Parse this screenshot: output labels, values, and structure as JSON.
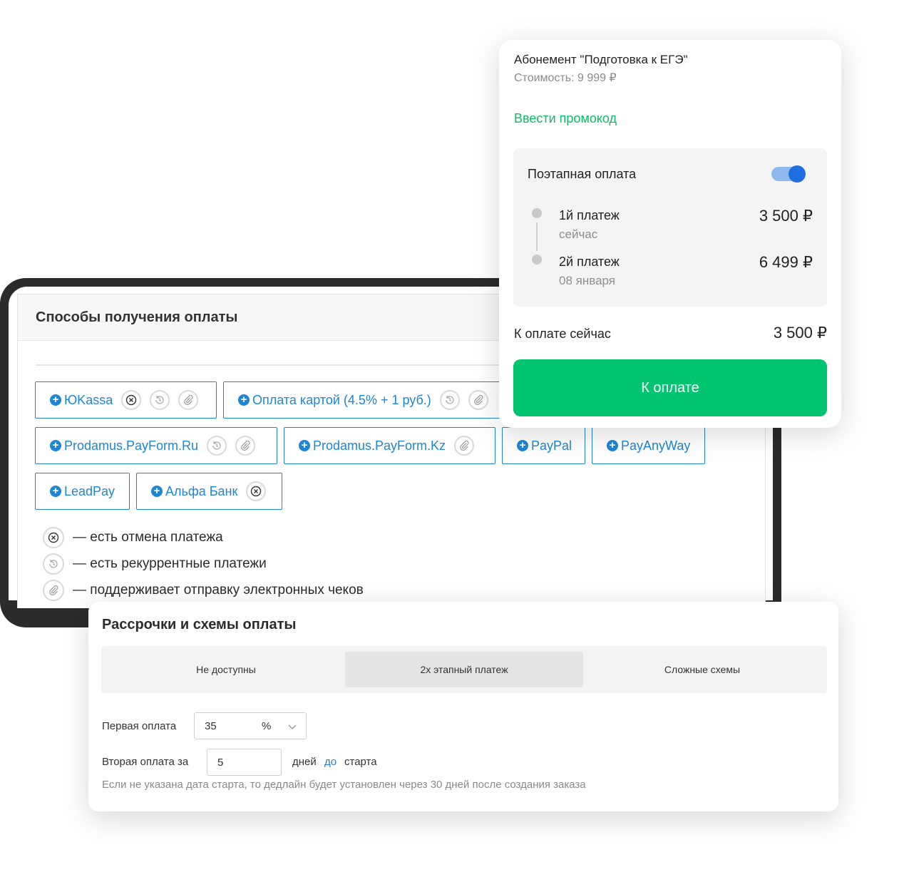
{
  "methods": {
    "title": "Способы получения оплаты",
    "buttons": [
      {
        "label": "ЮKassa"
      },
      {
        "label": "Оплата картой (4.5% + 1 руб.)"
      },
      {
        "label": "Prodamus.PayForm.Ru"
      },
      {
        "label": "Prodamus.PayForm.Kz"
      },
      {
        "label": "PayPal"
      },
      {
        "label": "PayAnyWay"
      },
      {
        "label": "LeadPay"
      },
      {
        "label": "Альфа Банк"
      }
    ],
    "legend": [
      {
        "icon": "cancel-icon",
        "text": "— есть отмена платежа"
      },
      {
        "icon": "recurring-icon",
        "text": "— есть рекуррентные платежи"
      },
      {
        "icon": "receipt-clip-icon",
        "text": "— поддерживает отправку электронных чеков"
      }
    ],
    "accent": "#1e86d4"
  },
  "checkout": {
    "title": "Абонемент \"Подготовка к ЕГЭ\"",
    "price": "Стоимость: 9 999 ₽",
    "promo_link": "Ввести промокод",
    "staged": {
      "label": "Поэтапная оплата",
      "enabled": true,
      "steps": [
        {
          "name": "1й платеж",
          "when": "сейчас",
          "amount": "3 500 ₽"
        },
        {
          "name": "2й платеж",
          "when": "08 января",
          "amount": "6 499 ₽"
        }
      ]
    },
    "due_label": "К оплате сейчас",
    "due_amount": "3 500 ₽",
    "pay_button": "К оплате",
    "accent": "#00c46f"
  },
  "installments": {
    "title": "Рассрочки и схемы оплаты",
    "options": [
      {
        "label": "Не доступны",
        "active": false
      },
      {
        "label": "2х этапный платеж",
        "active": true
      },
      {
        "label": "Сложные схемы",
        "active": false
      }
    ],
    "first_payment": {
      "label": "Первая оплата",
      "value": "35",
      "unit": "%"
    },
    "second_payment": {
      "label": "Вторая оплата за",
      "value": "5",
      "suffix_days": "дней",
      "suffix_link": "до",
      "suffix_end": "старта"
    },
    "hint": "Если не указана дата старта, то дедлайн будет установлен через 30 дней после создания заказа"
  }
}
